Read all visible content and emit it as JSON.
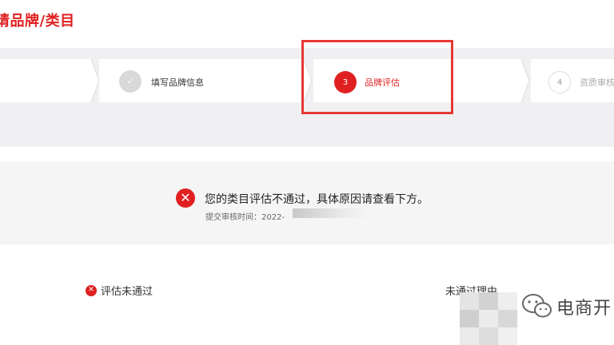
{
  "page": {
    "title": "请品牌/类目"
  },
  "steps": [
    {
      "number": "",
      "label": "",
      "state": "done"
    },
    {
      "number": "✓",
      "label": "填写品牌信息",
      "state": "done"
    },
    {
      "number": "3",
      "label": "品牌评估",
      "state": "active"
    },
    {
      "number": "4",
      "label": "资质审核",
      "state": "todo"
    }
  ],
  "result": {
    "message": "您的类目评估不通过，具体原因请查看下方。",
    "submit_time_label": "提交审核时间：2022-"
  },
  "status": {
    "icon": "✕",
    "text": "评估未通过",
    "reason_label": "未通过理由"
  },
  "watermark": {
    "text": "电商开"
  },
  "colors": {
    "accent": "#e02020",
    "band": "#f0f0f2",
    "highlight": "#e53935"
  }
}
